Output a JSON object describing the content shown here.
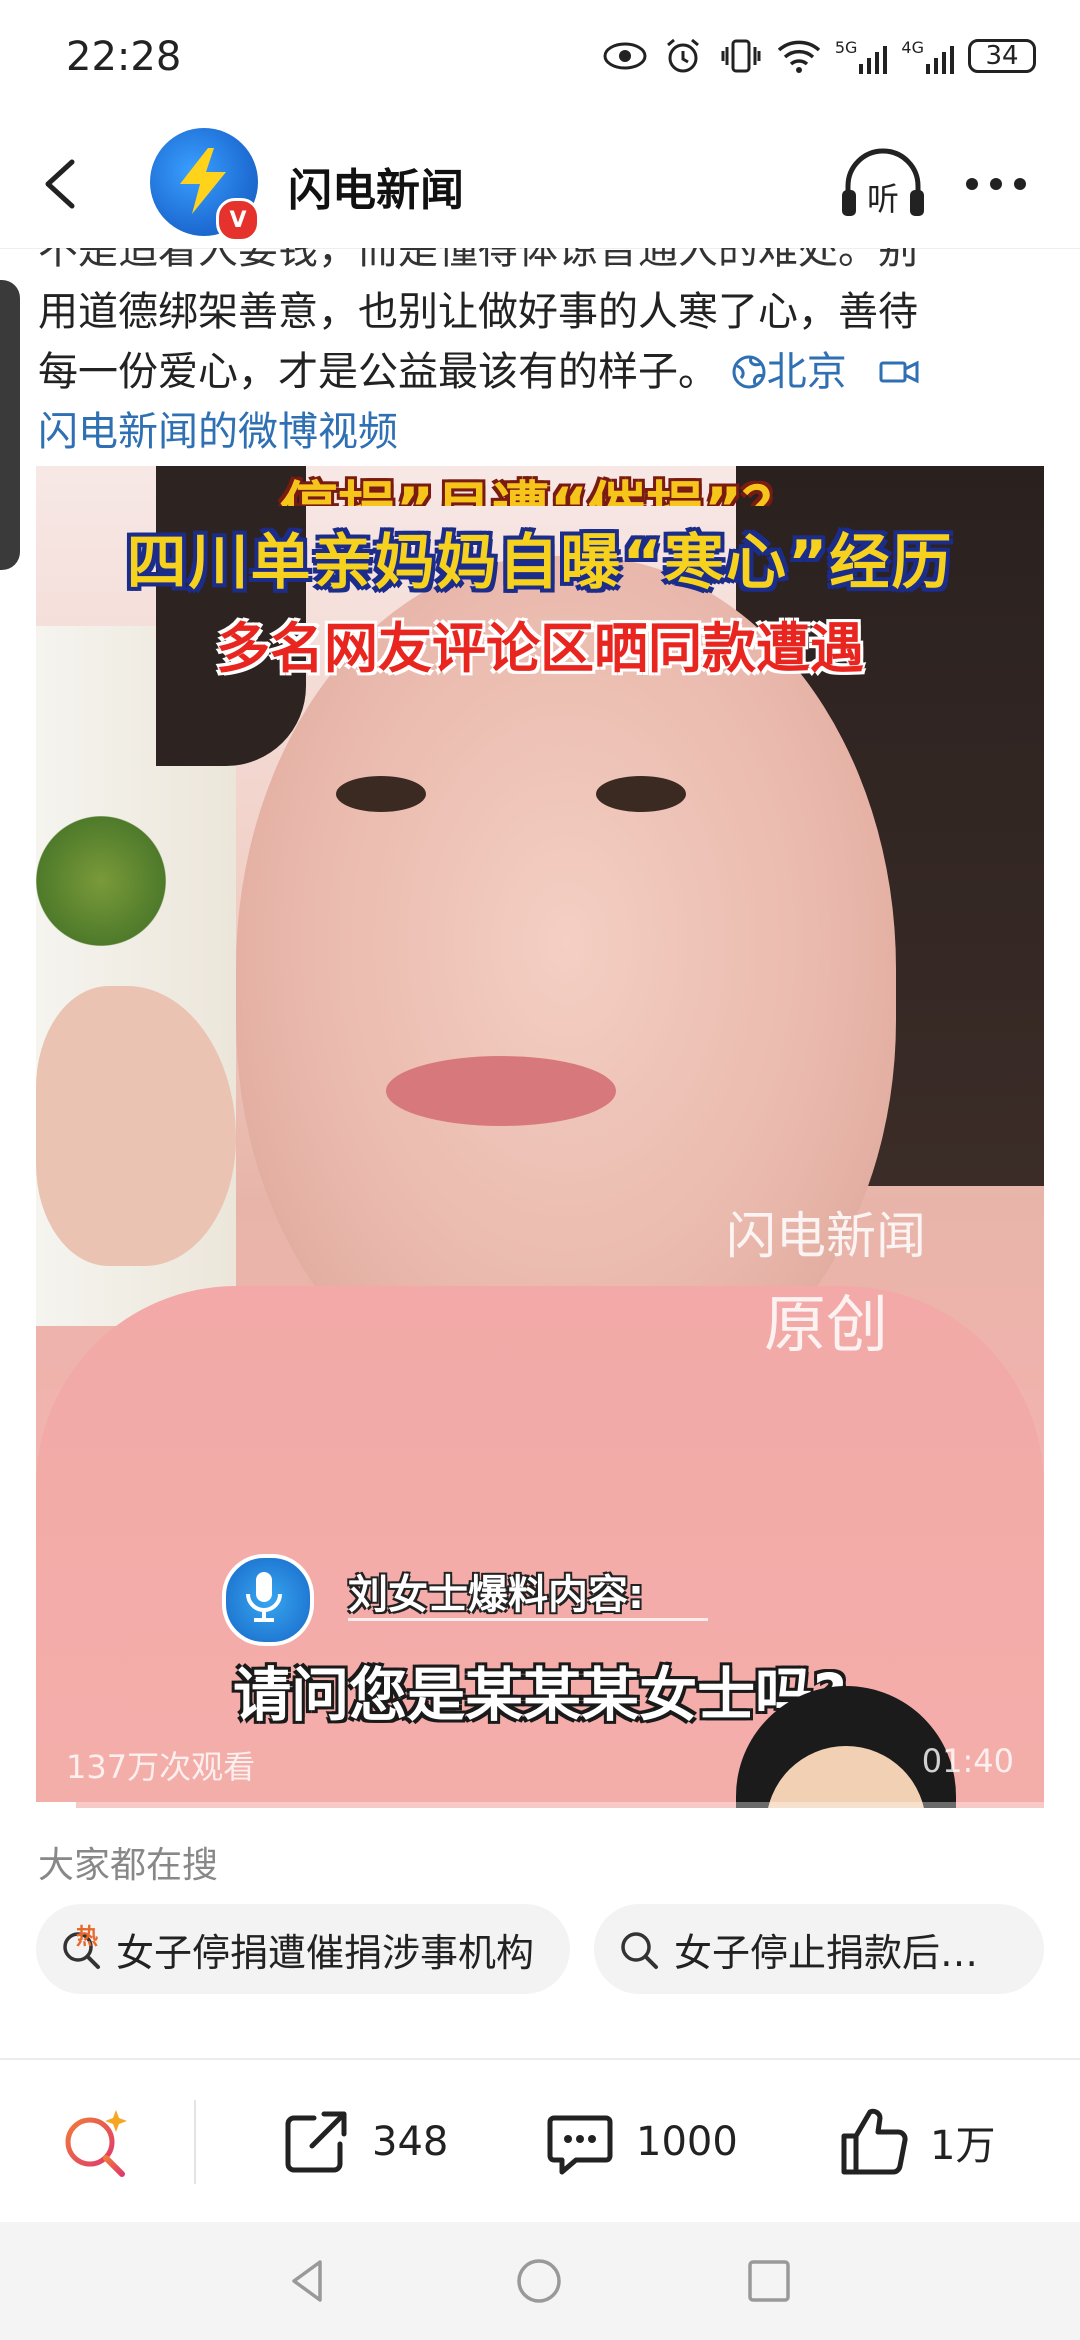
{
  "status_bar": {
    "time": "22:28",
    "net1": "5G",
    "net2": "4G",
    "battery": "34"
  },
  "header": {
    "account_name": "闪电新闻",
    "verified_badge": "V",
    "listen_label": "听"
  },
  "post": {
    "partial_line": "不是追着人要钱，而是懂得体谅普通人的难处。别",
    "line2": "用道德绑架善意，也别让做好事的人寒了心，善待",
    "line3_text": "每一份爱心，才是公益最该有的样子。",
    "location": "北京",
    "video_link": "闪电新闻的微博视频"
  },
  "video": {
    "top_partial_text": "停捐”月遭“催捐”？",
    "title": "四川单亲妈妈自曝“寒心”经历",
    "subtitle": "多名网友评论区晒同款遭遇",
    "watermark_line1": "闪电新闻",
    "watermark_line2": "原创",
    "speaker_label": "刘女士爆料内容:",
    "caption": "请问您是某某某女士吗?",
    "views": "137万次观看",
    "duration": "01:40",
    "progress": 0.04
  },
  "search": {
    "label": "大家都在搜",
    "hot_tag": "热",
    "items": [
      "女子停捐遭催捐涉事机构",
      "女子停止捐款后…"
    ]
  },
  "actions": {
    "share_count": "348",
    "comment_count": "1000",
    "like_count": "1万"
  },
  "colors": {
    "link": "#2f6fb3",
    "brand_blue": "#1f6fd6",
    "verified_red": "#e5322d"
  }
}
